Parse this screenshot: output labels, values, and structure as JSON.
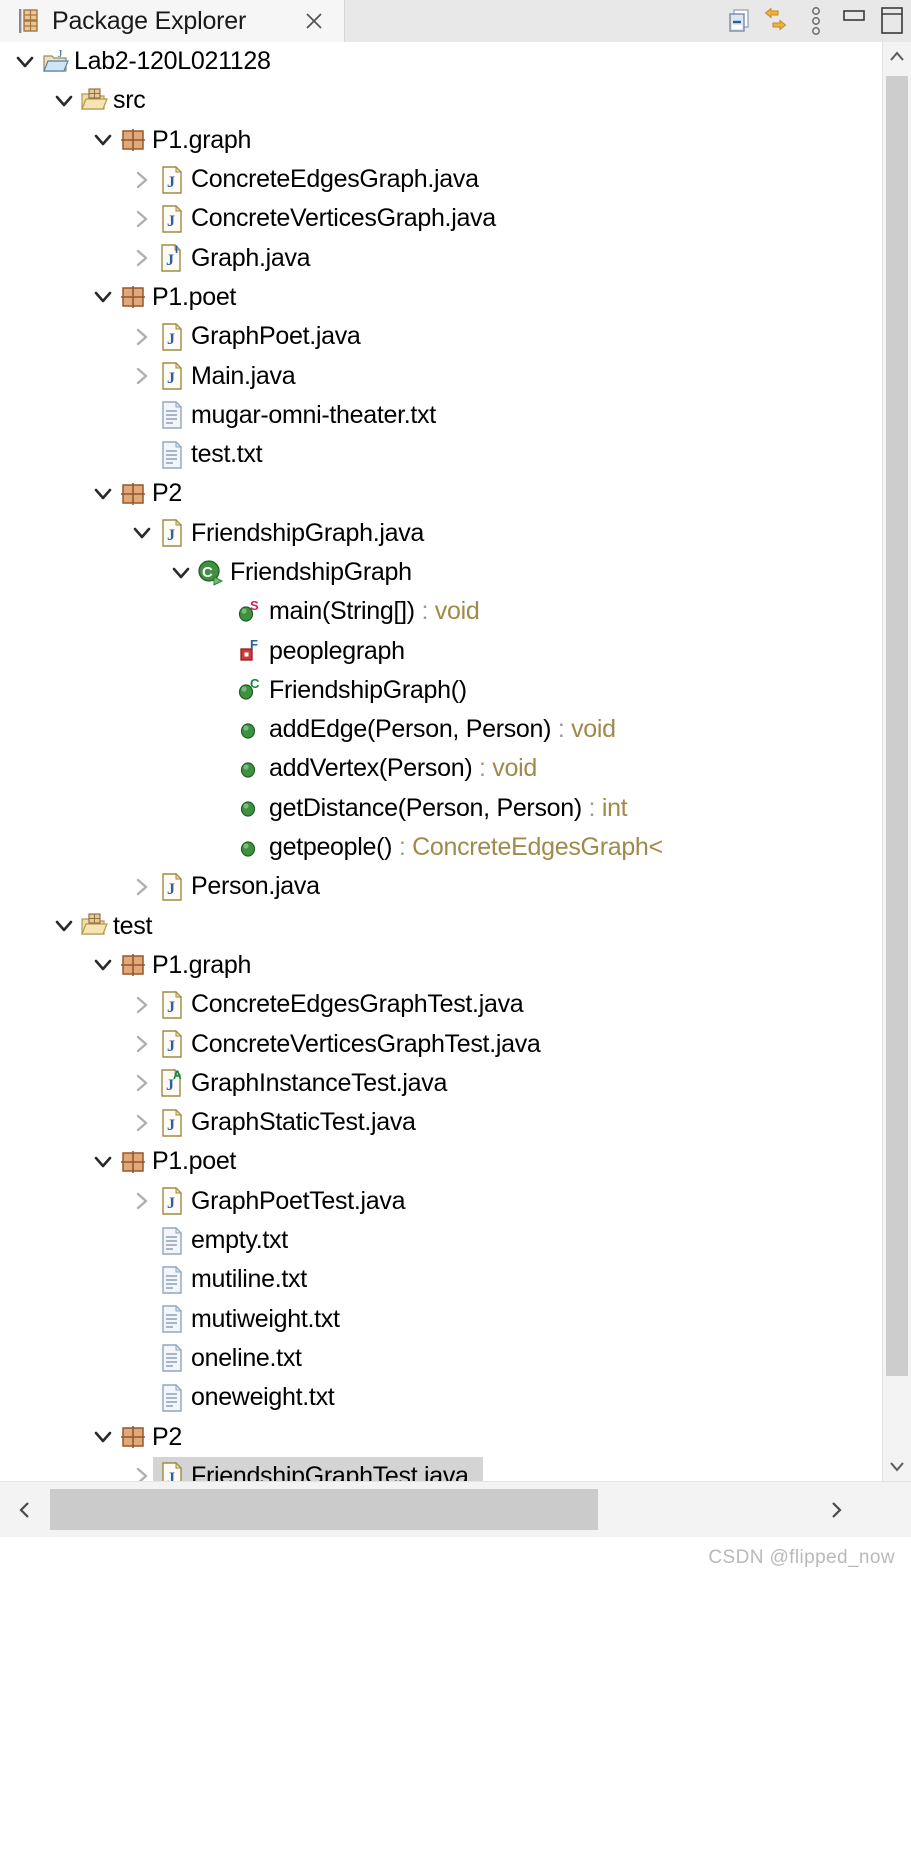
{
  "view": {
    "tab_label": "Package Explorer",
    "tab_icon": "package-explorer-icon",
    "close_icon": "close-icon"
  },
  "toolbar": {
    "buttons": [
      {
        "name": "collapse-all-icon",
        "tooltip": "Collapse All"
      },
      {
        "name": "link-with-editor-icon",
        "tooltip": "Link with Editor"
      },
      {
        "name": "view-menu-icon",
        "tooltip": "View Menu"
      },
      {
        "name": "minimize-icon",
        "tooltip": "Minimize"
      },
      {
        "name": "maximize-icon",
        "tooltip": "Maximize"
      }
    ]
  },
  "tree": {
    "rows": [
      {
        "depth": 0,
        "twisty": "down",
        "icon": "java-project-icon",
        "label": "Lab2-120L021128",
        "selected": false
      },
      {
        "depth": 1,
        "twisty": "down",
        "icon": "source-folder-icon",
        "label": "src",
        "selected": false
      },
      {
        "depth": 2,
        "twisty": "down",
        "icon": "package-icon",
        "label": "P1.graph",
        "selected": false
      },
      {
        "depth": 3,
        "twisty": "right",
        "icon": "java-file-icon",
        "label": "ConcreteEdgesGraph.java",
        "selected": false
      },
      {
        "depth": 3,
        "twisty": "right",
        "icon": "java-file-icon",
        "label": "ConcreteVerticesGraph.java",
        "selected": false
      },
      {
        "depth": 3,
        "twisty": "right",
        "icon": "java-file-interface-icon",
        "label": "Graph.java",
        "selected": false
      },
      {
        "depth": 2,
        "twisty": "down",
        "icon": "package-icon",
        "label": "P1.poet",
        "selected": false
      },
      {
        "depth": 3,
        "twisty": "right",
        "icon": "java-file-icon",
        "label": "GraphPoet.java",
        "selected": false
      },
      {
        "depth": 3,
        "twisty": "right",
        "icon": "java-file-icon",
        "label": "Main.java",
        "selected": false
      },
      {
        "depth": 3,
        "twisty": "none",
        "icon": "text-file-icon",
        "label": "mugar-omni-theater.txt",
        "selected": false
      },
      {
        "depth": 3,
        "twisty": "none",
        "icon": "text-file-icon",
        "label": "test.txt",
        "selected": false
      },
      {
        "depth": 2,
        "twisty": "down",
        "icon": "package-icon",
        "label": "P2",
        "selected": false
      },
      {
        "depth": 3,
        "twisty": "down",
        "icon": "java-file-icon",
        "label": "FriendshipGraph.java",
        "selected": false
      },
      {
        "depth": 4,
        "twisty": "down",
        "icon": "class-runnable-icon",
        "label": "FriendshipGraph",
        "selected": false
      },
      {
        "depth": 5,
        "twisty": "none",
        "icon": "method-public-static-icon",
        "label": "main(String[])",
        "colon": " : ",
        "rettype": "void",
        "selected": false
      },
      {
        "depth": 5,
        "twisty": "none",
        "icon": "field-private-final-icon",
        "label": "peoplegraph",
        "selected": false
      },
      {
        "depth": 5,
        "twisty": "none",
        "icon": "constructor-public-icon",
        "label": "FriendshipGraph()",
        "selected": false
      },
      {
        "depth": 5,
        "twisty": "none",
        "icon": "method-public-icon",
        "label": "addEdge(Person, Person)",
        "colon": " : ",
        "rettype": "void",
        "selected": false
      },
      {
        "depth": 5,
        "twisty": "none",
        "icon": "method-public-icon",
        "label": "addVertex(Person)",
        "colon": " : ",
        "rettype": "void",
        "selected": false
      },
      {
        "depth": 5,
        "twisty": "none",
        "icon": "method-public-icon",
        "label": "getDistance(Person, Person)",
        "colon": " : ",
        "rettype": "int",
        "selected": false
      },
      {
        "depth": 5,
        "twisty": "none",
        "icon": "method-public-icon",
        "label": "getpeople()",
        "colon": " : ",
        "rettype": "ConcreteEdgesGraph<",
        "selected": false
      },
      {
        "depth": 3,
        "twisty": "right",
        "icon": "java-file-icon",
        "label": "Person.java",
        "selected": false
      },
      {
        "depth": 1,
        "twisty": "down",
        "icon": "source-folder-icon",
        "label": "test",
        "selected": false
      },
      {
        "depth": 2,
        "twisty": "down",
        "icon": "package-icon",
        "label": "P1.graph",
        "selected": false
      },
      {
        "depth": 3,
        "twisty": "right",
        "icon": "java-file-icon",
        "label": "ConcreteEdgesGraphTest.java",
        "selected": false
      },
      {
        "depth": 3,
        "twisty": "right",
        "icon": "java-file-icon",
        "label": "ConcreteVerticesGraphTest.java",
        "selected": false
      },
      {
        "depth": 3,
        "twisty": "right",
        "icon": "java-file-abstract-icon",
        "label": "GraphInstanceTest.java",
        "selected": false
      },
      {
        "depth": 3,
        "twisty": "right",
        "icon": "java-file-icon",
        "label": "GraphStaticTest.java",
        "selected": false
      },
      {
        "depth": 2,
        "twisty": "down",
        "icon": "package-icon",
        "label": "P1.poet",
        "selected": false
      },
      {
        "depth": 3,
        "twisty": "right",
        "icon": "java-file-icon",
        "label": "GraphPoetTest.java",
        "selected": false
      },
      {
        "depth": 3,
        "twisty": "none",
        "icon": "text-file-icon",
        "label": "empty.txt",
        "selected": false
      },
      {
        "depth": 3,
        "twisty": "none",
        "icon": "text-file-icon",
        "label": "mutiline.txt",
        "selected": false
      },
      {
        "depth": 3,
        "twisty": "none",
        "icon": "text-file-icon",
        "label": "mutiweight.txt",
        "selected": false
      },
      {
        "depth": 3,
        "twisty": "none",
        "icon": "text-file-icon",
        "label": "oneline.txt",
        "selected": false
      },
      {
        "depth": 3,
        "twisty": "none",
        "icon": "text-file-icon",
        "label": "oneweight.txt",
        "selected": false
      },
      {
        "depth": 2,
        "twisty": "down",
        "icon": "package-icon",
        "label": "P2",
        "selected": false
      },
      {
        "depth": 3,
        "twisty": "right",
        "icon": "java-file-icon",
        "label": "FriendshipGraphTest.java",
        "selected": true
      }
    ]
  },
  "scrollbars": {
    "vertical": {
      "up_icon": "chevron-up-icon",
      "down_icon": "chevron-down-icon"
    },
    "horizontal": {
      "left_icon": "chevron-left-icon",
      "right_icon": "chevron-right-icon"
    }
  },
  "footer": {
    "watermark": "CSDN @flipped_now"
  },
  "colors": {
    "selection": "#d4d4d4",
    "tab_active": "#f6f6f6",
    "tabbar": "#e8e8e8",
    "return_type": "#a08a4b",
    "package_icon": "#c08a5e",
    "folder_icon": "#e8bb6d",
    "java_icon": "#4a6fa5",
    "method_green": "#3d8a3d",
    "field_red": "#d23b3b",
    "static_marker": "#d81b60",
    "abstract_marker": "#0e8a3e",
    "final_marker": "#2a6099",
    "scrollbar_thumb": "#cdcdcd"
  }
}
